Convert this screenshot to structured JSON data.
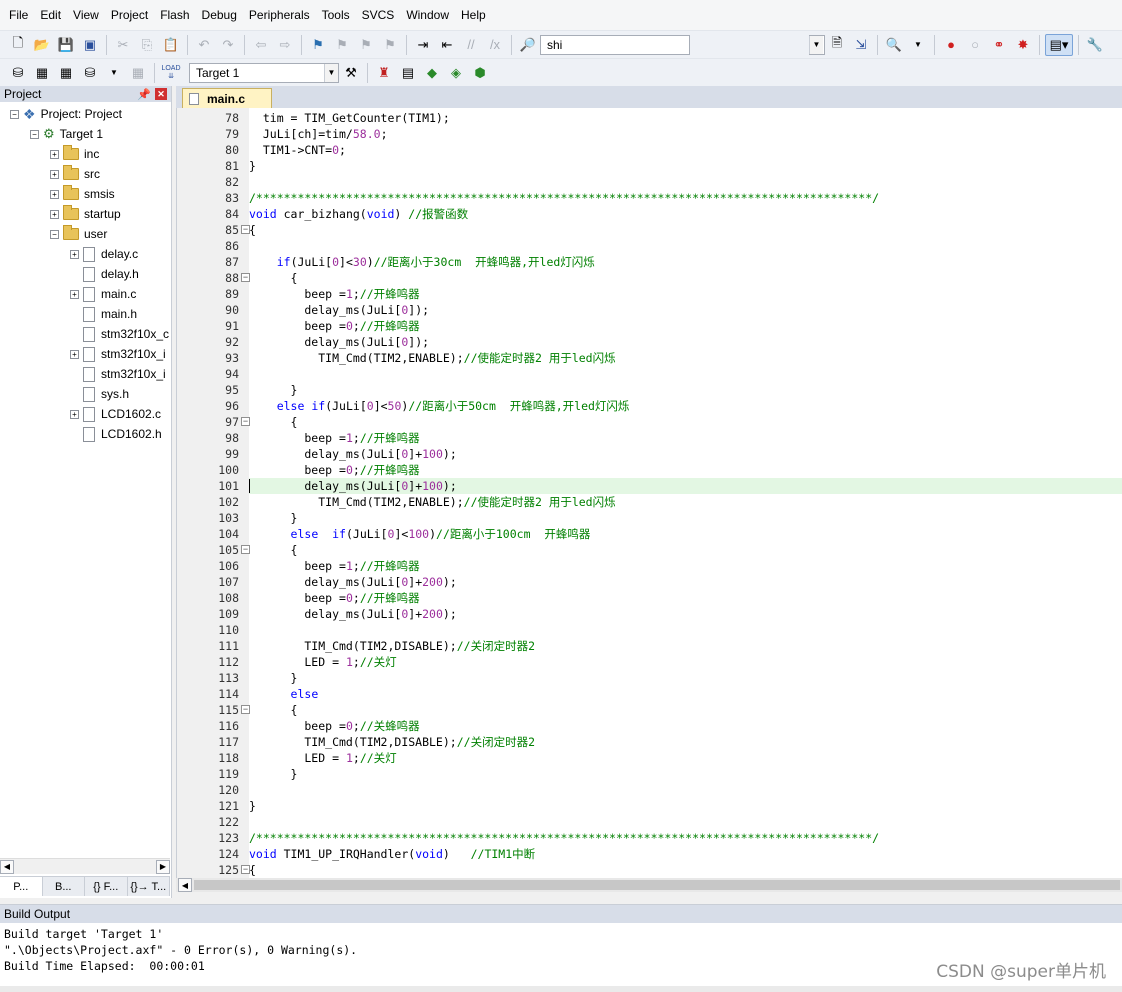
{
  "menu": [
    "File",
    "Edit",
    "View",
    "Project",
    "Flash",
    "Debug",
    "Peripherals",
    "Tools",
    "SVCS",
    "Window",
    "Help"
  ],
  "toolbar1": {
    "find_combo_value": "shi"
  },
  "toolbar2": {
    "load_label": "LOAD",
    "target_combo_value": "Target 1"
  },
  "project_panel": {
    "title": "Project",
    "tree": [
      {
        "label": "Project: Project",
        "type": "project",
        "level": 0
      },
      {
        "label": "Target 1",
        "type": "target",
        "level": 1
      },
      {
        "label": "inc",
        "type": "folder",
        "level": 2
      },
      {
        "label": "src",
        "type": "folder",
        "level": 2
      },
      {
        "label": "smsis",
        "type": "folder",
        "level": 2
      },
      {
        "label": "startup",
        "type": "folder",
        "level": 2
      },
      {
        "label": "user",
        "type": "folder",
        "level": 2
      },
      {
        "label": "delay.c",
        "type": "file",
        "level": 3
      },
      {
        "label": "delay.h",
        "type": "file",
        "level": 3
      },
      {
        "label": "main.c",
        "type": "file",
        "level": 3
      },
      {
        "label": "main.h",
        "type": "file",
        "level": 3
      },
      {
        "label": "stm32f10x_c",
        "type": "file",
        "level": 3
      },
      {
        "label": "stm32f10x_i",
        "type": "file",
        "level": 3
      },
      {
        "label": "stm32f10x_i",
        "type": "file",
        "level": 3
      },
      {
        "label": "sys.h",
        "type": "file",
        "level": 3
      },
      {
        "label": "LCD1602.c",
        "type": "file",
        "level": 3
      },
      {
        "label": "LCD1602.h",
        "type": "file",
        "level": 3
      }
    ],
    "tabs": [
      "P...",
      "B...",
      "{} F...",
      "{}→ T..."
    ]
  },
  "editor": {
    "tab_label": "main.c",
    "highlight_line": 101,
    "lines": [
      {
        "no": 78,
        "fold": "",
        "tokens": [
          [
            "tx",
            "  tim = TIM_GetCounter(TIM1);"
          ]
        ]
      },
      {
        "no": 79,
        "fold": "",
        "tokens": [
          [
            "tx",
            "  JuLi[ch]=tim/"
          ],
          [
            "num",
            "58.0"
          ],
          [
            "tx",
            ";"
          ]
        ]
      },
      {
        "no": 80,
        "fold": "",
        "tokens": [
          [
            "tx",
            "  TIM1->CNT="
          ],
          [
            "num",
            "0"
          ],
          [
            "tx",
            ";"
          ]
        ]
      },
      {
        "no": 81,
        "fold": "",
        "tokens": [
          [
            "tx",
            "}"
          ]
        ]
      },
      {
        "no": 82,
        "fold": "",
        "tokens": []
      },
      {
        "no": 83,
        "fold": "",
        "tokens": [
          [
            "cm",
            "/*****************************************************************************************/"
          ]
        ]
      },
      {
        "no": 84,
        "fold": "",
        "tokens": [
          [
            "kw",
            "void"
          ],
          [
            "tx",
            " car_bizhang("
          ],
          [
            "kw",
            "void"
          ],
          [
            "tx",
            ") "
          ],
          [
            "cm",
            "//报警函数"
          ]
        ]
      },
      {
        "no": 85,
        "fold": "-",
        "tokens": [
          [
            "tx",
            "{"
          ]
        ]
      },
      {
        "no": 86,
        "fold": "",
        "tokens": []
      },
      {
        "no": 87,
        "fold": "",
        "tokens": [
          [
            "tx",
            "    "
          ],
          [
            "kw",
            "if"
          ],
          [
            "tx",
            "(JuLi["
          ],
          [
            "num",
            "0"
          ],
          [
            "tx",
            "]<"
          ],
          [
            "num",
            "30"
          ],
          [
            "tx",
            ")"
          ],
          [
            "cm",
            "//距离小于30cm  开蜂鸣器,开led灯闪烁"
          ]
        ]
      },
      {
        "no": 88,
        "fold": "-",
        "tokens": [
          [
            "tx",
            "      {"
          ]
        ]
      },
      {
        "no": 89,
        "fold": "",
        "tokens": [
          [
            "tx",
            "        beep ="
          ],
          [
            "num",
            "1"
          ],
          [
            "tx",
            ";"
          ],
          [
            "cm",
            "//开蜂鸣器"
          ]
        ]
      },
      {
        "no": 90,
        "fold": "",
        "tokens": [
          [
            "tx",
            "        delay_ms(JuLi["
          ],
          [
            "num",
            "0"
          ],
          [
            "tx",
            "]);"
          ]
        ]
      },
      {
        "no": 91,
        "fold": "",
        "tokens": [
          [
            "tx",
            "        beep ="
          ],
          [
            "num",
            "0"
          ],
          [
            "tx",
            ";"
          ],
          [
            "cm",
            "//开蜂鸣器"
          ]
        ]
      },
      {
        "no": 92,
        "fold": "",
        "tokens": [
          [
            "tx",
            "        delay_ms(JuLi["
          ],
          [
            "num",
            "0"
          ],
          [
            "tx",
            "]);"
          ]
        ]
      },
      {
        "no": 93,
        "fold": "",
        "tokens": [
          [
            "tx",
            "          TIM_Cmd(TIM2,ENABLE);"
          ],
          [
            "cm",
            "//使能定时器2 用于led闪烁"
          ]
        ]
      },
      {
        "no": 94,
        "fold": "",
        "tokens": []
      },
      {
        "no": 95,
        "fold": "",
        "tokens": [
          [
            "tx",
            "      }"
          ]
        ]
      },
      {
        "no": 96,
        "fold": "",
        "tokens": [
          [
            "tx",
            "    "
          ],
          [
            "kw",
            "else"
          ],
          [
            "tx",
            " "
          ],
          [
            "kw",
            "if"
          ],
          [
            "tx",
            "(JuLi["
          ],
          [
            "num",
            "0"
          ],
          [
            "tx",
            "]<"
          ],
          [
            "num",
            "50"
          ],
          [
            "tx",
            ")"
          ],
          [
            "cm",
            "//距离小于50cm  开蜂鸣器,开led灯闪烁"
          ]
        ]
      },
      {
        "no": 97,
        "fold": "-",
        "tokens": [
          [
            "tx",
            "      {"
          ]
        ]
      },
      {
        "no": 98,
        "fold": "",
        "tokens": [
          [
            "tx",
            "        beep ="
          ],
          [
            "num",
            "1"
          ],
          [
            "tx",
            ";"
          ],
          [
            "cm",
            "//开蜂鸣器"
          ]
        ]
      },
      {
        "no": 99,
        "fold": "",
        "tokens": [
          [
            "tx",
            "        delay_ms(JuLi["
          ],
          [
            "num",
            "0"
          ],
          [
            "tx",
            "]+"
          ],
          [
            "num",
            "100"
          ],
          [
            "tx",
            ");"
          ]
        ]
      },
      {
        "no": 100,
        "fold": "",
        "tokens": [
          [
            "tx",
            "        beep ="
          ],
          [
            "num",
            "0"
          ],
          [
            "tx",
            ";"
          ],
          [
            "cm",
            "//开蜂鸣器"
          ]
        ]
      },
      {
        "no": 101,
        "fold": "",
        "tokens": [
          [
            "tx",
            "        delay_ms(JuLi["
          ],
          [
            "num",
            "0"
          ],
          [
            "tx",
            "]+"
          ],
          [
            "num",
            "100"
          ],
          [
            "tx",
            ");"
          ]
        ]
      },
      {
        "no": 102,
        "fold": "",
        "tokens": [
          [
            "tx",
            "          TIM_Cmd(TIM2,ENABLE);"
          ],
          [
            "cm",
            "//使能定时器2 用于led闪烁"
          ]
        ]
      },
      {
        "no": 103,
        "fold": "",
        "tokens": [
          [
            "tx",
            "      }"
          ]
        ]
      },
      {
        "no": 104,
        "fold": "",
        "tokens": [
          [
            "tx",
            "      "
          ],
          [
            "kw",
            "else"
          ],
          [
            "tx",
            "  "
          ],
          [
            "kw",
            "if"
          ],
          [
            "tx",
            "(JuLi["
          ],
          [
            "num",
            "0"
          ],
          [
            "tx",
            "]<"
          ],
          [
            "num",
            "100"
          ],
          [
            "tx",
            ")"
          ],
          [
            "cm",
            "//距离小于100cm  开蜂鸣器"
          ]
        ]
      },
      {
        "no": 105,
        "fold": "-",
        "tokens": [
          [
            "tx",
            "      {"
          ]
        ]
      },
      {
        "no": 106,
        "fold": "",
        "tokens": [
          [
            "tx",
            "        beep ="
          ],
          [
            "num",
            "1"
          ],
          [
            "tx",
            ";"
          ],
          [
            "cm",
            "//开蜂鸣器"
          ]
        ]
      },
      {
        "no": 107,
        "fold": "",
        "tokens": [
          [
            "tx",
            "        delay_ms(JuLi["
          ],
          [
            "num",
            "0"
          ],
          [
            "tx",
            "]+"
          ],
          [
            "num",
            "200"
          ],
          [
            "tx",
            ");"
          ]
        ]
      },
      {
        "no": 108,
        "fold": "",
        "tokens": [
          [
            "tx",
            "        beep ="
          ],
          [
            "num",
            "0"
          ],
          [
            "tx",
            ";"
          ],
          [
            "cm",
            "//开蜂鸣器"
          ]
        ]
      },
      {
        "no": 109,
        "fold": "",
        "tokens": [
          [
            "tx",
            "        delay_ms(JuLi["
          ],
          [
            "num",
            "0"
          ],
          [
            "tx",
            "]+"
          ],
          [
            "num",
            "200"
          ],
          [
            "tx",
            ");"
          ]
        ]
      },
      {
        "no": 110,
        "fold": "",
        "tokens": []
      },
      {
        "no": 111,
        "fold": "",
        "tokens": [
          [
            "tx",
            "        TIM_Cmd(TIM2,DISABLE);"
          ],
          [
            "cm",
            "//关闭定时器2"
          ]
        ]
      },
      {
        "no": 112,
        "fold": "",
        "tokens": [
          [
            "tx",
            "        LED = "
          ],
          [
            "num",
            "1"
          ],
          [
            "tx",
            ";"
          ],
          [
            "cm",
            "//关灯"
          ]
        ]
      },
      {
        "no": 113,
        "fold": "",
        "tokens": [
          [
            "tx",
            "      }"
          ]
        ]
      },
      {
        "no": 114,
        "fold": "",
        "tokens": [
          [
            "tx",
            "      "
          ],
          [
            "kw",
            "else"
          ]
        ]
      },
      {
        "no": 115,
        "fold": "-",
        "tokens": [
          [
            "tx",
            "      {"
          ]
        ]
      },
      {
        "no": 116,
        "fold": "",
        "tokens": [
          [
            "tx",
            "        beep ="
          ],
          [
            "num",
            "0"
          ],
          [
            "tx",
            ";"
          ],
          [
            "cm",
            "//关蜂鸣器"
          ]
        ]
      },
      {
        "no": 117,
        "fold": "",
        "tokens": [
          [
            "tx",
            "        TIM_Cmd(TIM2,DISABLE);"
          ],
          [
            "cm",
            "//关闭定时器2"
          ]
        ]
      },
      {
        "no": 118,
        "fold": "",
        "tokens": [
          [
            "tx",
            "        LED = "
          ],
          [
            "num",
            "1"
          ],
          [
            "tx",
            ";"
          ],
          [
            "cm",
            "//关灯"
          ]
        ]
      },
      {
        "no": 119,
        "fold": "",
        "tokens": [
          [
            "tx",
            "      }"
          ]
        ]
      },
      {
        "no": 120,
        "fold": "",
        "tokens": []
      },
      {
        "no": 121,
        "fold": "",
        "tokens": [
          [
            "tx",
            "}"
          ]
        ]
      },
      {
        "no": 122,
        "fold": "",
        "tokens": []
      },
      {
        "no": 123,
        "fold": "",
        "tokens": [
          [
            "cm",
            "/*****************************************************************************************/"
          ]
        ]
      },
      {
        "no": 124,
        "fold": "",
        "tokens": [
          [
            "kw",
            "void"
          ],
          [
            "tx",
            " TIM1_UP_IRQHandler("
          ],
          [
            "kw",
            "void"
          ],
          [
            "tx",
            ")   "
          ],
          [
            "cm",
            "//TIM1中断"
          ]
        ]
      },
      {
        "no": 125,
        "fold": "-",
        "tokens": [
          [
            "tx",
            "{"
          ]
        ]
      }
    ]
  },
  "build_output": {
    "title": "Build Output",
    "lines": [
      "Build target 'Target 1'",
      "\".\\Objects\\Project.axf\" - 0 Error(s), 0 Warning(s).",
      "Build Time Elapsed:  00:00:01"
    ]
  },
  "watermark": "CSDN @super单片机",
  "colors": {
    "keyword": "#0000ff",
    "number": "#9c2f9c",
    "comment": "#008000",
    "highlight_line": "#e3f7e3",
    "editor_tab": "#fff3c4"
  }
}
